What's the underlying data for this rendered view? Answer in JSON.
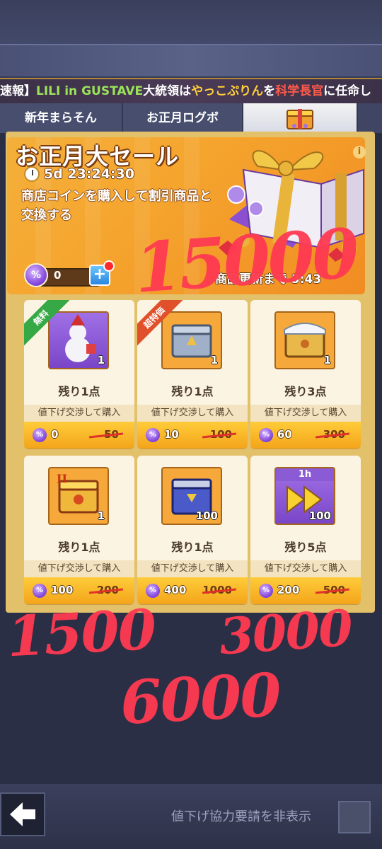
{
  "news_ticker": {
    "parts": [
      {
        "text": "速報】",
        "color": "white"
      },
      {
        "text": "LILI in GUSTAVE",
        "color": "green"
      },
      {
        "text": "大統領は",
        "color": "white"
      },
      {
        "text": "やっこぷりん",
        "color": "yellow"
      },
      {
        "text": "を",
        "color": "white"
      },
      {
        "text": "科学長官",
        "color": "red"
      },
      {
        "text": "に任命し",
        "color": "white"
      }
    ]
  },
  "tabs": [
    {
      "label": "新年まらそん"
    },
    {
      "label": "お正月ログボ"
    },
    {
      "label": ""
    }
  ],
  "event": {
    "title": "お正月大セール",
    "timer": "5d 23:24:30",
    "description": "商店コインを購入して割引商品と交換する",
    "coin_balance": "0",
    "refresh_label": "商品更新まで 3:43"
  },
  "shop": {
    "items": [
      {
        "name": "snowman",
        "ribbon": "無料",
        "ribbon_color": "green",
        "qty": "1",
        "remaining": "残り1点",
        "action": "値下げ交渉して購入",
        "price": "0",
        "old_price": "50"
      },
      {
        "name": "silver-chest",
        "ribbon": "超特価",
        "ribbon_color": "red",
        "qty": "1",
        "remaining": "残り1点",
        "action": "値下げ交渉して購入",
        "price": "10",
        "old_price": "100"
      },
      {
        "name": "snow-chest",
        "ribbon": "",
        "ribbon_color": "",
        "qty": "1",
        "remaining": "残り3点",
        "action": "値下げ交渉して購入",
        "price": "60",
        "old_price": "300"
      },
      {
        "name": "gold-chest-ii",
        "ribbon": "",
        "ribbon_color": "",
        "qty": "1",
        "remaining": "残り1点",
        "action": "値下げ交渉して購入",
        "price": "100",
        "old_price": "200"
      },
      {
        "name": "blue-chest",
        "ribbon": "",
        "ribbon_color": "",
        "qty": "100",
        "remaining": "残り1点",
        "action": "値下げ交渉して購入",
        "price": "400",
        "old_price": "1000"
      },
      {
        "name": "speedup-1h",
        "ribbon": "",
        "ribbon_color": "",
        "qty": "100",
        "hour_label": "1h",
        "remaining": "残り5点",
        "action": "値下げ交渉して購入",
        "price": "200",
        "old_price": "500"
      }
    ]
  },
  "handwritten_notes": [
    "15000",
    "1500",
    "3000",
    "6000"
  ],
  "footer": {
    "hide_label": "値下げ協力要請を非表示"
  },
  "colors": {
    "accent_orange": "#f5a52e",
    "price_bar": "#f3a41a",
    "annotation_red": "#ff3a52"
  }
}
